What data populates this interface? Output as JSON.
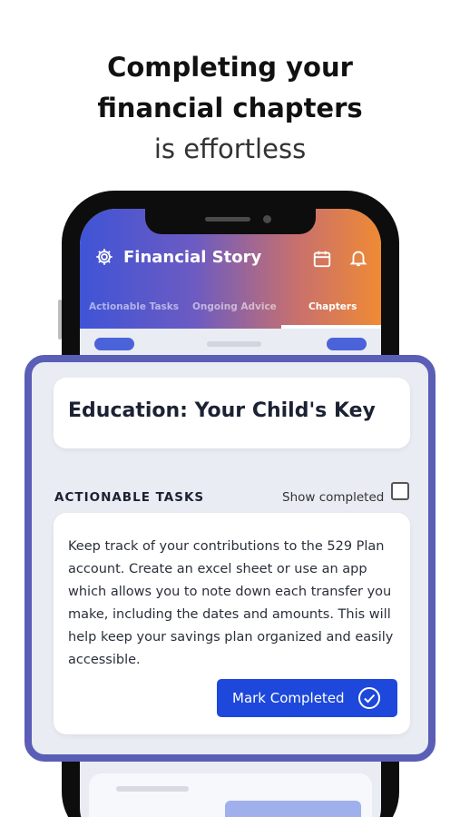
{
  "headline": {
    "line1": "Completing your",
    "line2": "financial chapters",
    "line3": "is effortless"
  },
  "app": {
    "title": "Financial Story",
    "icons": [
      "gear-icon",
      "calendar-icon",
      "bell-icon"
    ],
    "tabs": [
      "Actionable Tasks",
      "Ongoing Advice",
      "Chapters"
    ],
    "active_tab": "Chapters"
  },
  "chapter": {
    "title": "Education: Your Child's Key",
    "section_label": "ACTIONABLE TASKS",
    "show_completed_label": "Show completed",
    "show_completed_checked": false,
    "task": {
      "text": "Keep track of your contributions to the 529 Plan account. Create an excel sheet or use an app which allows you to note down each transfer you make, including the dates and amounts. This will help keep your savings plan organized and easily accessible.",
      "button_label": "Mark Completed"
    }
  },
  "colors": {
    "panel_border": "#5a5eb6",
    "button": "#1d48db",
    "header_start": "#3f54d6",
    "header_end": "#ef8a34"
  }
}
